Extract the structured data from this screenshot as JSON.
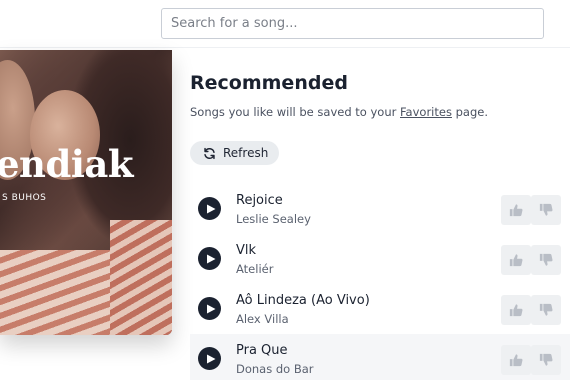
{
  "search": {
    "placeholder": "Search for a song..."
  },
  "album": {
    "title_partial": "endiak",
    "subtitle_partial": "S BUHOS"
  },
  "recommended": {
    "heading": "Recommended",
    "description_prefix": "Songs you like will be saved to your ",
    "favorites_link": "Favorites",
    "description_suffix": " page.",
    "refresh_label": "Refresh"
  },
  "songs": [
    {
      "title": "Rejoice",
      "artist": "Leslie Sealey"
    },
    {
      "title": "Vlk",
      "artist": "Ateliér"
    },
    {
      "title": "Aô Lindeza (Ao Vivo)",
      "artist": "Alex Villa"
    },
    {
      "title": "Pra Que",
      "artist": "Donas do Bar"
    }
  ],
  "icons": {
    "play": "play-icon",
    "thumbs_up": "thumbs-up-icon",
    "thumbs_down": "thumbs-down-icon",
    "refresh": "refresh-icon"
  },
  "colors": {
    "dark": "#1b2230",
    "button_bg": "#e9ecef",
    "thumb_bg": "#eef0f2",
    "thumb_icon": "#b9bec6"
  }
}
